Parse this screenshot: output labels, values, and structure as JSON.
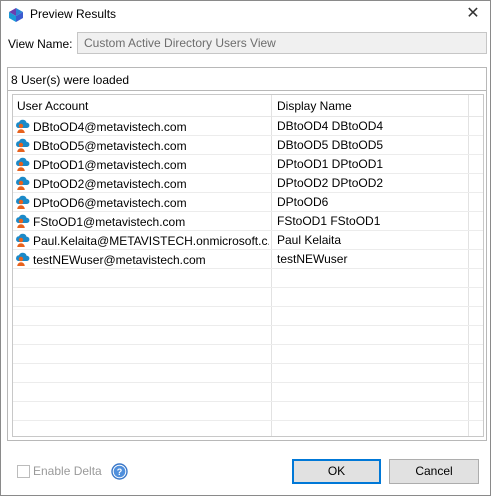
{
  "window": {
    "title": "Preview Results",
    "close_glyph": "✕"
  },
  "view_name": {
    "label": "View Name:",
    "value": "Custom Active Directory Users View"
  },
  "results": {
    "status_text": "8 User(s) were loaded",
    "columns": {
      "account": "User Account",
      "display": "Display Name"
    },
    "rows": [
      {
        "account": "DBtoOD4@metavistech.com",
        "display": "DBtoOD4 DBtoOD4"
      },
      {
        "account": "DBtoOD5@metavistech.com",
        "display": "DBtoOD5 DBtoOD5"
      },
      {
        "account": "DPtoOD1@metavistech.com",
        "display": "DPtoOD1 DPtoOD1"
      },
      {
        "account": "DPtoOD2@metavistech.com",
        "display": "DPtoOD2 DPtoOD2"
      },
      {
        "account": "DPtoOD6@metavistech.com",
        "display": "DPtoOD6"
      },
      {
        "account": "FStoOD1@metavistech.com",
        "display": "FStoOD1 FStoOD1"
      },
      {
        "account": "Paul.Kelaita@METAVISTECH.onmicrosoft.c...",
        "display": "Paul Kelaita"
      },
      {
        "account": "testNEWuser@metavistech.com",
        "display": "testNEWuser"
      }
    ],
    "row_icon": "cloud-user-icon"
  },
  "footer": {
    "enable_delta_label": "Enable Delta",
    "enable_delta_checked": false,
    "help_icon": "help-icon",
    "ok_label": "OK",
    "cancel_label": "Cancel"
  },
  "colors": {
    "accent": "#0078d7",
    "user_icon_cloud": "#1b8ac9",
    "user_icon_person": "#e8621d"
  }
}
